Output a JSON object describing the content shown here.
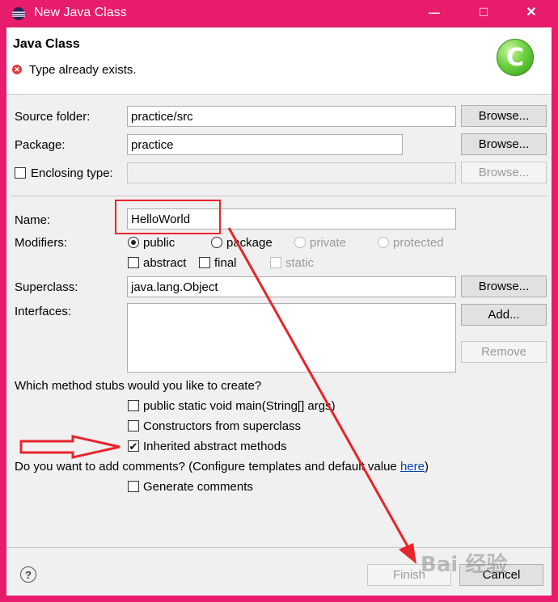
{
  "window": {
    "title": "New Java Class",
    "minimize_glyph": "—",
    "maximize_glyph": "□",
    "close_glyph": "✕",
    "frame_color": "#e81c6d"
  },
  "header": {
    "title": "Java Class",
    "message": "Type already exists.",
    "class_icon_letter": "C"
  },
  "form": {
    "source_folder": {
      "label": "Source folder:",
      "value": "practice/src",
      "button": "Browse..."
    },
    "package": {
      "label": "Package:",
      "value": "practice",
      "button": "Browse..."
    },
    "enclosing_type": {
      "label": "Enclosing type:",
      "value": "",
      "button": "Browse...",
      "checked": false
    },
    "name": {
      "label": "Name:",
      "value": "HelloWorld"
    },
    "modifiers": {
      "label": "Modifiers:",
      "radios": [
        {
          "label": "public",
          "selected": true,
          "enabled": true
        },
        {
          "label": "package",
          "selected": false,
          "enabled": true
        },
        {
          "label": "private",
          "selected": false,
          "enabled": false
        },
        {
          "label": "protected",
          "selected": false,
          "enabled": false
        }
      ],
      "checks": [
        {
          "label": "abstract",
          "checked": false,
          "enabled": true
        },
        {
          "label": "final",
          "checked": false,
          "enabled": true
        },
        {
          "label": "static",
          "checked": false,
          "enabled": false
        }
      ]
    },
    "superclass": {
      "label": "Superclass:",
      "value": "java.lang.Object",
      "button": "Browse..."
    },
    "interfaces": {
      "label": "Interfaces:",
      "add_button": "Add...",
      "remove_button": "Remove"
    },
    "stubs": {
      "question": "Which method stubs would you like to create?",
      "options": [
        {
          "label": "public static void main(String[] args)",
          "checked": false
        },
        {
          "label": "Constructors from superclass",
          "checked": false
        },
        {
          "label": "Inherited abstract methods",
          "checked": true
        }
      ]
    },
    "comments": {
      "question": "Do you want to add comments? (Configure templates and default value ",
      "link": "here",
      "close_paren": ")",
      "option": {
        "label": "Generate comments",
        "checked": false
      }
    }
  },
  "footer": {
    "help_glyph": "?",
    "finish_button": "Finish",
    "cancel_button": "Cancel"
  },
  "watermark": "Bai 经验",
  "annotation_color": "#e8242c"
}
